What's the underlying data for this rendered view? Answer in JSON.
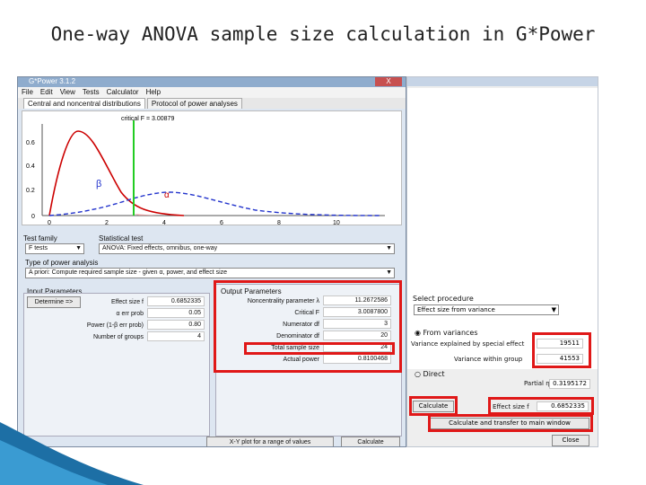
{
  "slide": {
    "title": "One-way ANOVA sample size calculation in G*Power"
  },
  "window": {
    "title": "G*Power 3.1.2",
    "close_label": "X",
    "menu": [
      "File",
      "Edit",
      "View",
      "Tests",
      "Calculator",
      "Help"
    ],
    "tabs": [
      "Central and noncentral distributions",
      "Protocol of power analyses"
    ],
    "plot": {
      "critical_label": "critical F = 3.00879",
      "y_ticks": [
        "0.6",
        "0.4",
        "0.2",
        "0"
      ],
      "x_ticks": [
        "0",
        "2",
        "4",
        "6",
        "8",
        "10"
      ],
      "beta": "β",
      "alpha": "α"
    },
    "test_family_label": "Test family",
    "test_family_value": "F tests",
    "statistical_test_label": "Statistical test",
    "statistical_test_value": "ANOVA: Fixed effects, omnibus, one-way",
    "power_type_label": "Type of power analysis",
    "power_type_value": "A priori: Compute required sample size - given α, power, and effect size",
    "input": {
      "title": "Input Parameters",
      "determine_label": "Determine =>",
      "rows": [
        {
          "name": "Effect size f",
          "value": "0.6852335"
        },
        {
          "name": "α err prob",
          "value": "0.05"
        },
        {
          "name": "Power (1-β err prob)",
          "value": "0.80"
        },
        {
          "name": "Number of groups",
          "value": "4"
        }
      ]
    },
    "output": {
      "title": "Output Parameters",
      "rows": [
        {
          "name": "Noncentrality parameter λ",
          "value": "11.2672586"
        },
        {
          "name": "Critical F",
          "value": "3.0087800"
        },
        {
          "name": "Numerator df",
          "value": "3"
        },
        {
          "name": "Denominator df",
          "value": "20"
        },
        {
          "name": "Total sample size",
          "value": "24"
        },
        {
          "name": "Actual power",
          "value": "0.8100468"
        }
      ]
    },
    "xy_plot_button": "X-Y plot for a range of values",
    "calculate_button": "Calculate"
  },
  "effect_size_dialog": {
    "select_procedure_label": "Select procedure",
    "procedure_value": "Effect size from variance",
    "from_variances_label": "From variances",
    "variance_effect_label": "Variance explained by special effect",
    "variance_effect_value": "19511",
    "variance_within_label": "Variance within group",
    "variance_within_value": "41553",
    "direct_label": "Direct",
    "partial_eta_label": "Partial η²",
    "partial_eta_value": "0.3195172",
    "calculate_button": "Calculate",
    "effect_size_label": "Effect size f",
    "effect_size_value": "0.6852335",
    "calc_transfer_button": "Calculate and transfer to main window",
    "close_button": "Close"
  },
  "colors": {
    "highlight": "#e01818",
    "critical_line": "#22cc22",
    "beta_curve": "#cc0000",
    "alpha_curve": "#2233cc"
  }
}
